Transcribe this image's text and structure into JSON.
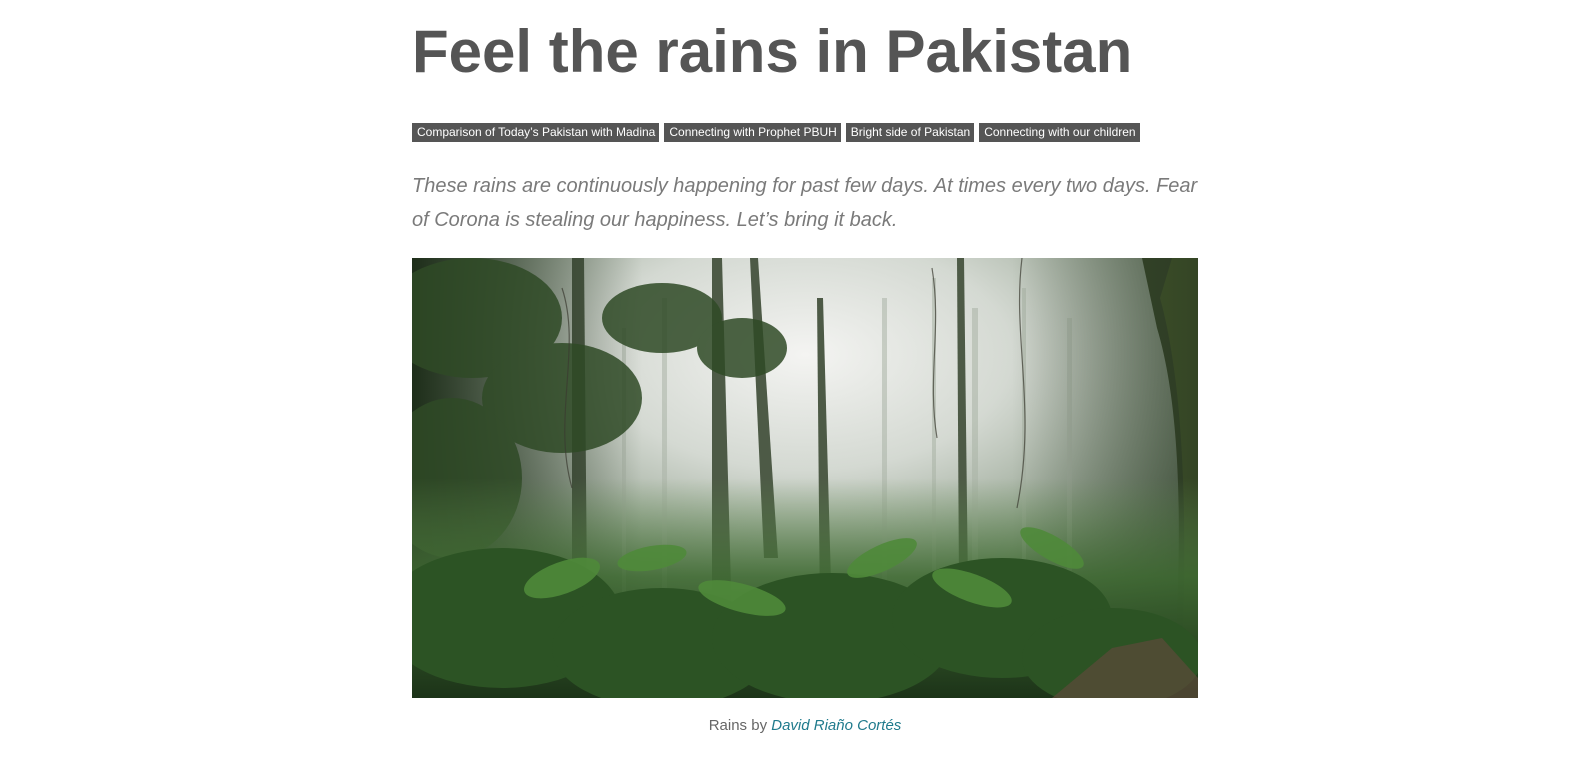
{
  "article": {
    "title": "Feel the rains in Pakistan",
    "tags": [
      {
        "label": "Comparison of Today’s Pakistan with Madina"
      },
      {
        "label": "Connecting with Prophet PBUH"
      },
      {
        "label": "Bright side of Pakistan"
      },
      {
        "label": "Connecting with our children"
      }
    ],
    "lead": "These rains are continuously happening for past few days. At times every two days. Fear of Corona is stealing our happiness. Let’s bring it back.",
    "image": {
      "subject": "misty rainforest with tall trees and green undergrowth"
    },
    "caption": {
      "prefix": "Rains by ",
      "credit": "David Riaño Cortés"
    }
  },
  "colors": {
    "title": "#555555",
    "tag_background": "#555555",
    "tag_text": "#ffffff",
    "lead_text": "#7a7a7a",
    "caption_text": "#666666",
    "credit_link": "#1f7a8c"
  }
}
